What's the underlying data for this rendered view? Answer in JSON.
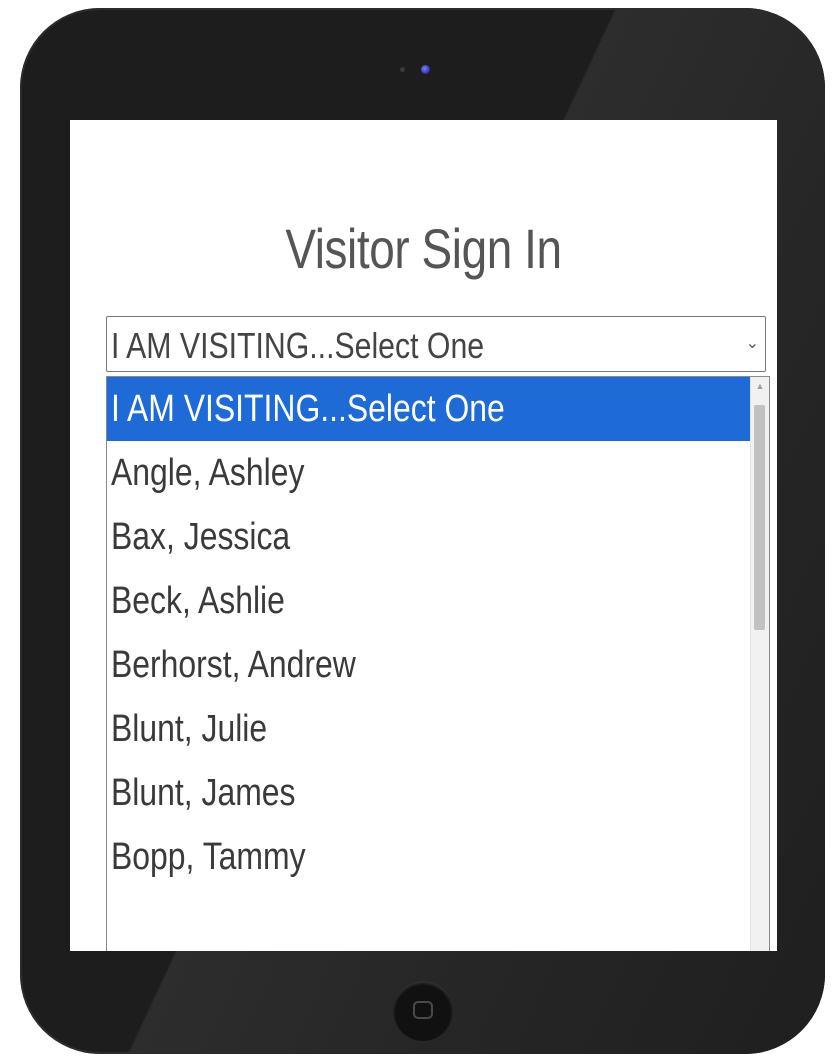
{
  "page": {
    "title": "Visitor Sign In"
  },
  "visiting_select": {
    "selected_label": "I AM VISITING...Select One",
    "arrow_icon": "chevron-down-icon"
  },
  "dropdown": {
    "options": [
      "I AM VISITING...Select One",
      "Angle, Ashley",
      "Bax, Jessica",
      "Beck, Ashlie",
      "Berhorst, Andrew",
      "Blunt, Julie",
      "Blunt, James",
      "Bopp, Tammy"
    ],
    "highlighted_index": 0
  },
  "colors": {
    "highlight": "#1e6ad6",
    "device_frame": "#1d1d1d",
    "title_text": "#555555"
  }
}
